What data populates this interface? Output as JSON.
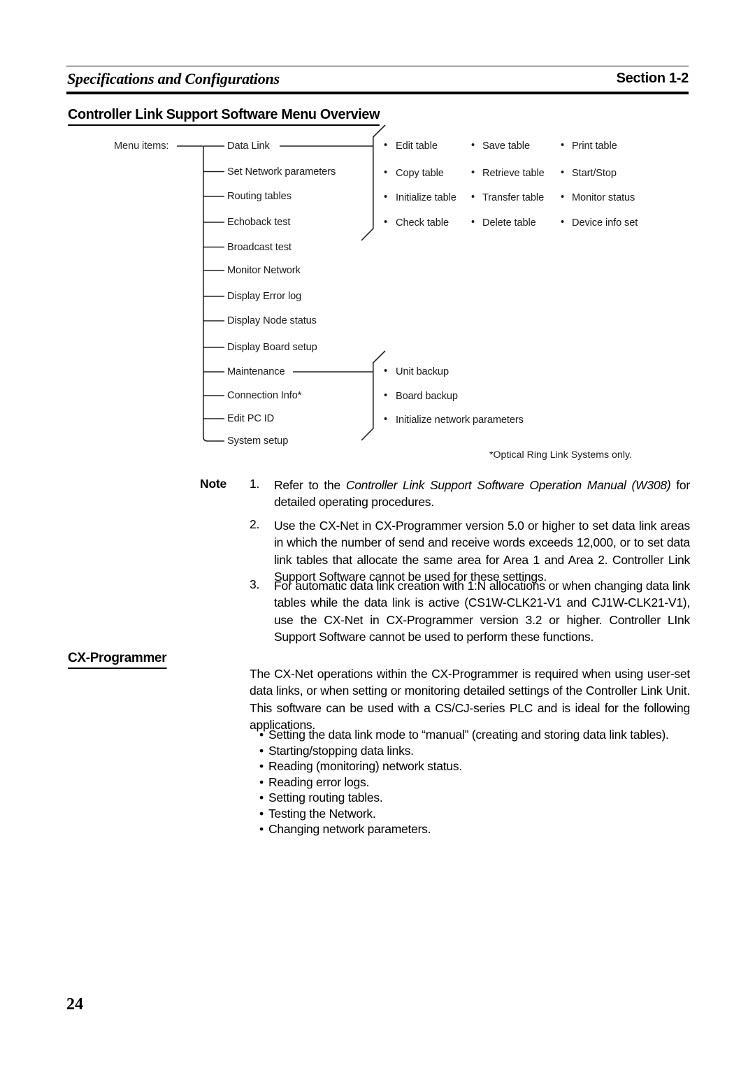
{
  "header": {
    "running_title": "Specifications and Configurations",
    "section_label": "Section 1-2"
  },
  "section_heading": "Controller Link Support Software Menu Overview",
  "diagram": {
    "root_label": "Menu items:",
    "menu_items": [
      "Data Link",
      "Set Network parameters",
      "Routing tables",
      "Echoback test",
      "Broadcast test",
      "Monitor Network",
      "Display Error log",
      "Display Node status",
      "Display Board setup",
      "Maintenance",
      "Connection Info*",
      "Edit PC ID",
      "System setup"
    ],
    "data_link_submenu": {
      "columns": [
        [
          "Edit table",
          "Copy table",
          "Initialize table",
          "Check table"
        ],
        [
          "Save table",
          "Retrieve table",
          "Transfer table",
          "Delete table"
        ],
        [
          "Print table",
          "Start/Stop",
          "Monitor status",
          "Device info set"
        ]
      ]
    },
    "maintenance_submenu": [
      "Unit backup",
      "Board backup",
      "Initialize network parameters"
    ],
    "footnote": "*Optical Ring Link Systems only.",
    "bullet_glyph": "•"
  },
  "note": {
    "label": "Note",
    "items": [
      {
        "number": "1.",
        "text_before": "Refer to the ",
        "italic": "Controller Link Support Software Operation Manual (W308)",
        "text_after": " for detailed operating procedures."
      },
      {
        "number": "2.",
        "text": "Use the CX-Net in CX-Programmer version 5.0 or higher to set data link areas in which the number of send and receive words exceeds 12,000, or to set data link tables that allocate the same area for Area 1 and Area 2. Controller Link Support Software cannot be used for these settings."
      },
      {
        "number": "3.",
        "text": "For automatic data link creation with 1:N allocations or when changing data link tables while the data link is active (CS1W-CLK21-V1 and CJ1W-CLK21-V1), use the CX-Net in CX-Programmer version 3.2 or higher. Controller LInk Support Software cannot be used to perform these functions."
      }
    ]
  },
  "cx_programmer": {
    "heading": "CX-Programmer",
    "paragraph": "The CX-Net operations within the CX-Programmer is required when using user-set data links, or when setting or monitoring detailed settings of the Controller Link Unit. This software can be used with a CS/CJ-series PLC and is ideal for the following applications.",
    "bullet_glyph": "•",
    "bullets": [
      "Setting the data link mode to “manual” (creating and storing data link tables).",
      "Starting/stopping data links.",
      "Reading (monitoring) network status.",
      "Reading error logs.",
      "Setting routing tables.",
      "Testing the Network.",
      "Changing network parameters."
    ]
  },
  "page_number": "24"
}
